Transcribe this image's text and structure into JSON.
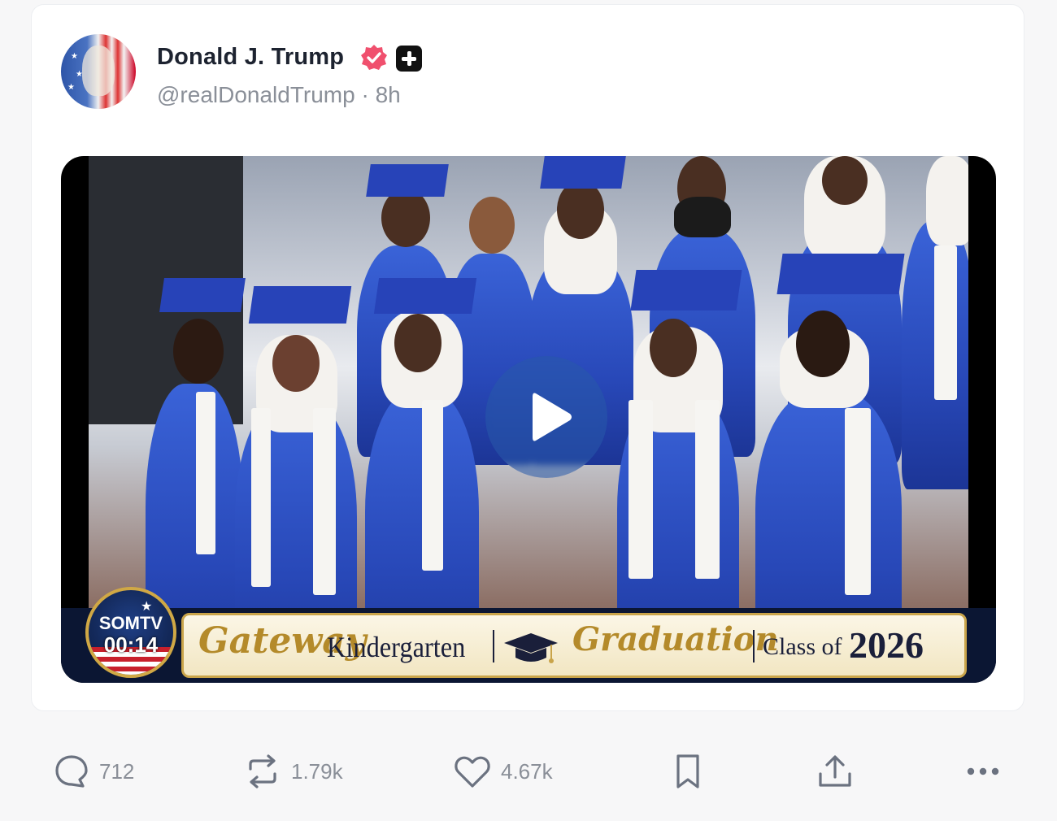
{
  "post": {
    "author_name": "Donald J. Trump",
    "handle": "@realDonaldTrump",
    "separator": "·",
    "time_ago": "8h"
  },
  "video": {
    "overlay": {
      "channel": "SOMTV",
      "timestamp": "00:14",
      "banner_word1": "Gateway",
      "banner_word2": "Kindergarten",
      "banner_word3": "Graduation",
      "banner_word4": "Class of",
      "banner_year": "2026"
    }
  },
  "actions": {
    "reply_count": "712",
    "repost_count": "1.79k",
    "like_count": "4.67k",
    "icons": [
      "reply-icon",
      "repost-icon",
      "like-icon",
      "bookmark-icon",
      "share-icon",
      "more-icon"
    ]
  },
  "colors": {
    "verified": "#f0506e",
    "muted_text": "#8a8f98",
    "name_text": "#1d2330"
  }
}
